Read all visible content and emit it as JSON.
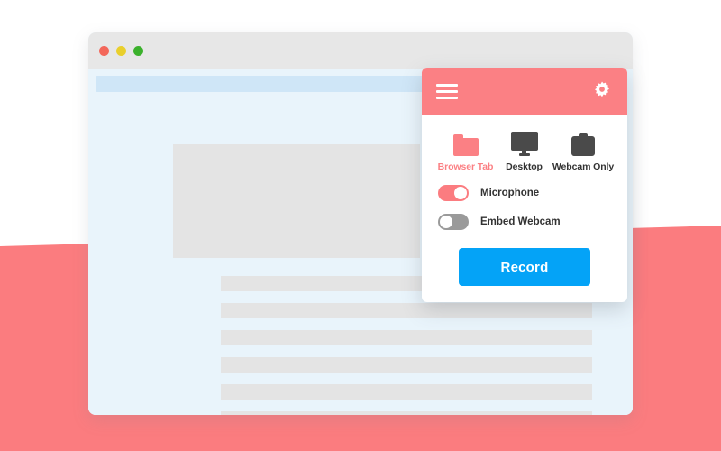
{
  "colors": {
    "brand_pink": "#FB8084",
    "record_blue": "#04A3F7",
    "icon_dark": "#4A4A4A",
    "browser_bg": "#E9F4FB",
    "placeholder_gray": "#E4E4E4",
    "titlebar_gray": "#E7E7E7"
  },
  "browser": {
    "traffic_lights": [
      {
        "name": "close",
        "color": "#F3675A"
      },
      {
        "name": "minimize",
        "color": "#E9CF2C"
      },
      {
        "name": "maximize",
        "color": "#3BB12C"
      }
    ],
    "address_bar_value": "",
    "content_placeholder_lines": 6
  },
  "panel": {
    "header": {
      "menu_icon": "hamburger-menu-icon",
      "settings_icon": "gear-icon"
    },
    "sources": [
      {
        "label": "Browser Tab",
        "icon": "folder-icon",
        "selected": true
      },
      {
        "label": "Desktop",
        "icon": "monitor-icon",
        "selected": false
      },
      {
        "label": "Webcam Only",
        "icon": "camera-icon",
        "selected": false
      }
    ],
    "toggles": [
      {
        "label": "Microphone",
        "state": "on"
      },
      {
        "label": "Embed Webcam",
        "state": "off"
      }
    ],
    "record_button_label": "Record"
  }
}
